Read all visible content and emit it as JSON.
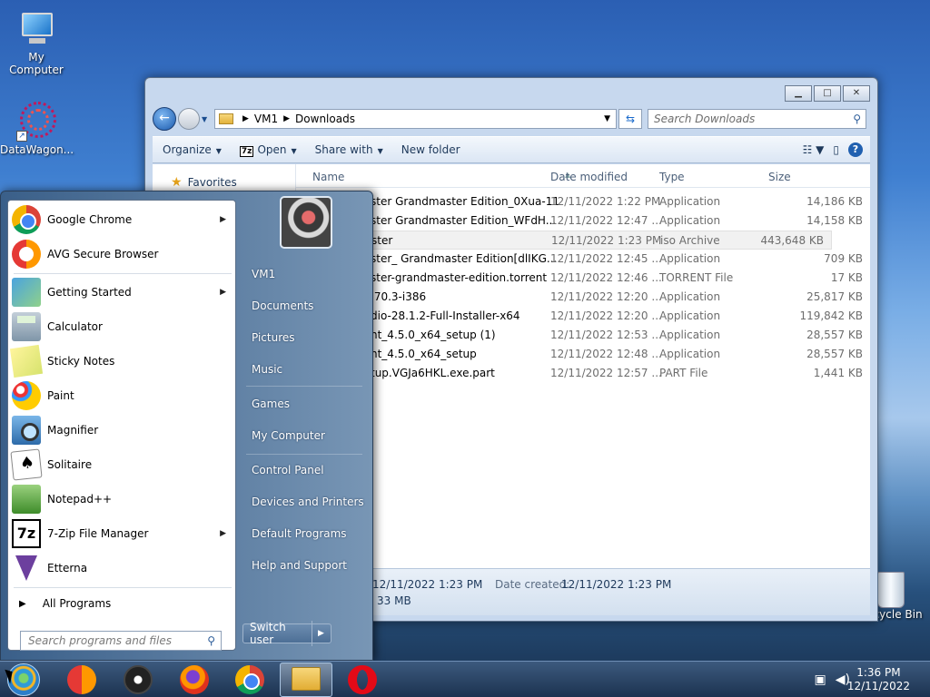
{
  "desktop": {
    "icons": [
      {
        "label": "My Computer"
      },
      {
        "label": "DataWagon..."
      },
      {
        "label": "Recycle Bin"
      }
    ]
  },
  "explorer": {
    "breadcrumb": [
      "VM1",
      "Downloads"
    ],
    "search_placeholder": "Search Downloads",
    "toolbar": {
      "organize": "Organize",
      "open": "Open",
      "open_badge": "7z",
      "share_with": "Share with",
      "new_folder": "New folder"
    },
    "nav": {
      "favorites": "Favorites"
    },
    "columns": {
      "name": "Name",
      "date": "Date modified",
      "type": "Type",
      "size": "Size"
    },
    "files": [
      {
        "name": "ster Grandmaster Edition_0Xua-11",
        "date": "12/11/2022 1:22 PM",
        "type": "Application",
        "size": "14,186 KB"
      },
      {
        "name": "ster Grandmaster Edition_WFdH...",
        "date": "12/11/2022 12:47 ...",
        "type": "Application",
        "size": "14,158 KB"
      },
      {
        "name": "ster",
        "date": "12/11/2022 1:23 PM",
        "type": "iso Archive",
        "size": "443,648 KB",
        "selected": true
      },
      {
        "name": "ster_ Grandmaster Edition[dlIKG...",
        "date": "12/11/2022 12:45 ...",
        "type": "Application",
        "size": "709 KB"
      },
      {
        "name": "ster-grandmaster-edition.torrent",
        "date": "12/11/2022 12:46 ...",
        "type": "TORRENT File",
        "size": "17 KB"
      },
      {
        "name": ".70.3-i386",
        "date": "12/11/2022 12:20 ...",
        "type": "Application",
        "size": "25,817 KB"
      },
      {
        "name": "dio-28.1.2-Full-Installer-x64",
        "date": "12/11/2022 12:20 ...",
        "type": "Application",
        "size": "119,842 KB"
      },
      {
        "name": "nt_4.5.0_x64_setup (1)",
        "date": "12/11/2022 12:53 ...",
        "type": "Application",
        "size": "28,557 KB"
      },
      {
        "name": "nt_4.5.0_x64_setup",
        "date": "12/11/2022 12:48 ...",
        "type": "Application",
        "size": "28,557 KB"
      },
      {
        "name": "tup.VGJa6HKL.exe.part",
        "date": "12/11/2022 12:57 ...",
        "type": "PART File",
        "size": "1,441 KB"
      }
    ],
    "details": {
      "modified_value": "12/11/2022 1:23 PM",
      "created_label": "Date created:",
      "created_value": "12/11/2022 1:23 PM",
      "size_value": "33 MB"
    }
  },
  "start_menu": {
    "pinned": [
      {
        "label": "Google Chrome",
        "submenu": true
      },
      {
        "label": "AVG Secure Browser",
        "submenu": false
      }
    ],
    "recent": [
      {
        "label": "Getting Started",
        "submenu": true
      },
      {
        "label": "Calculator",
        "submenu": false
      },
      {
        "label": "Sticky Notes",
        "submenu": false
      },
      {
        "label": "Paint",
        "submenu": false
      },
      {
        "label": "Magnifier",
        "submenu": false
      },
      {
        "label": "Solitaire",
        "submenu": false
      },
      {
        "label": "Notepad++",
        "submenu": false
      },
      {
        "label": "7-Zip File Manager",
        "submenu": true
      },
      {
        "label": "Etterna",
        "submenu": false
      }
    ],
    "all_programs": "All Programs",
    "search_placeholder": "Search programs and files",
    "right": [
      "VM1",
      "Documents",
      "Pictures",
      "Music",
      "Games",
      "My Computer",
      "Control Panel",
      "Devices and Printers",
      "Default Programs",
      "Help and Support"
    ],
    "switch_user": "Switch user",
    "seven_zip_glyph": "7z"
  },
  "taskbar": {
    "clock_time": "1:36 PM",
    "clock_date": "12/11/2022",
    "pinned_icons": [
      "avg-browser-icon",
      "obs-icon",
      "firefox-icon",
      "chrome-icon",
      "file-explorer-icon",
      "opera-icon"
    ]
  }
}
